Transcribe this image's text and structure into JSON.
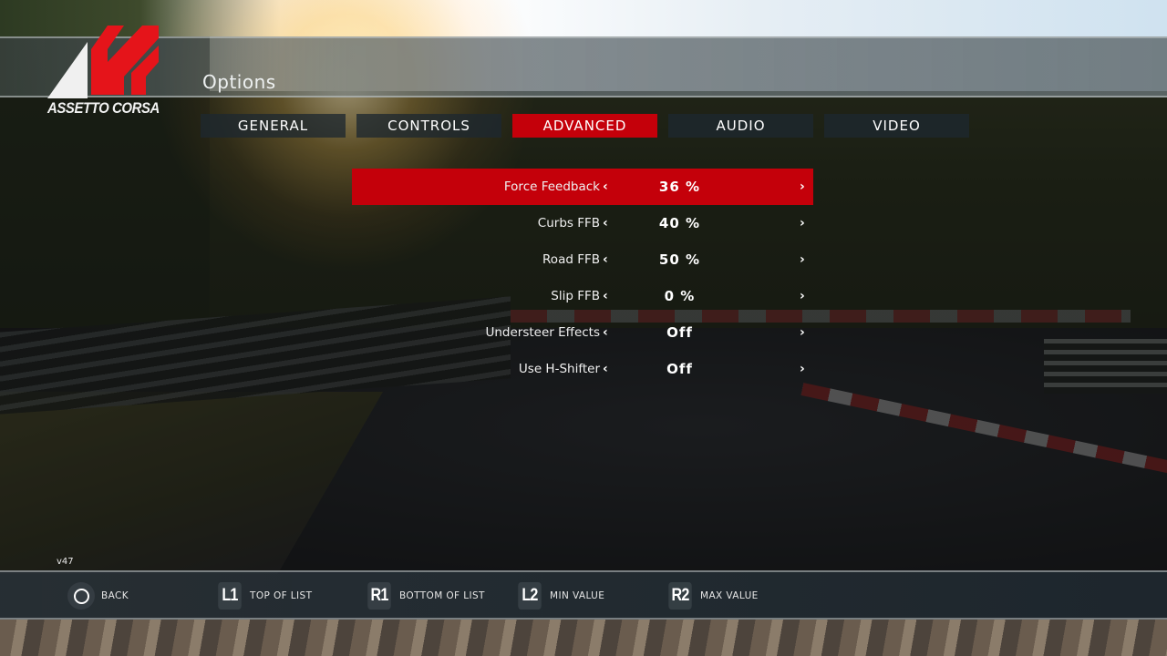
{
  "brand": {
    "name": "ASSETTO CORSA",
    "logo_icon": "assetto-corsa-logo",
    "accent_color": "#c4000a"
  },
  "header": {
    "title": "Options"
  },
  "tabs": [
    {
      "label": "GENERAL",
      "active": false
    },
    {
      "label": "CONTROLS",
      "active": false
    },
    {
      "label": "ADVANCED",
      "active": true
    },
    {
      "label": "AUDIO",
      "active": false
    },
    {
      "label": "VIDEO",
      "active": false
    }
  ],
  "settings": [
    {
      "label": "Force Feedback",
      "value": "36 %",
      "selected": true
    },
    {
      "label": "Curbs FFB",
      "value": "40 %",
      "selected": false
    },
    {
      "label": "Road FFB",
      "value": "50 %",
      "selected": false
    },
    {
      "label": "Slip FFB",
      "value": "0 %",
      "selected": false
    },
    {
      "label": "Understeer Effects",
      "value": "Off",
      "selected": false
    },
    {
      "label": "Use H-Shifter",
      "value": "Off",
      "selected": false
    }
  ],
  "arrows": {
    "left": "‹",
    "right": "›"
  },
  "version": "v47",
  "footer": {
    "hints": [
      {
        "button": "circle",
        "label": "BACK"
      },
      {
        "button": "L1",
        "label": "TOP OF LIST"
      },
      {
        "button": "R1",
        "label": "BOTTOM OF LIST"
      },
      {
        "button": "L2",
        "label": "MIN VALUE"
      },
      {
        "button": "R2",
        "label": "MAX VALUE"
      }
    ]
  }
}
